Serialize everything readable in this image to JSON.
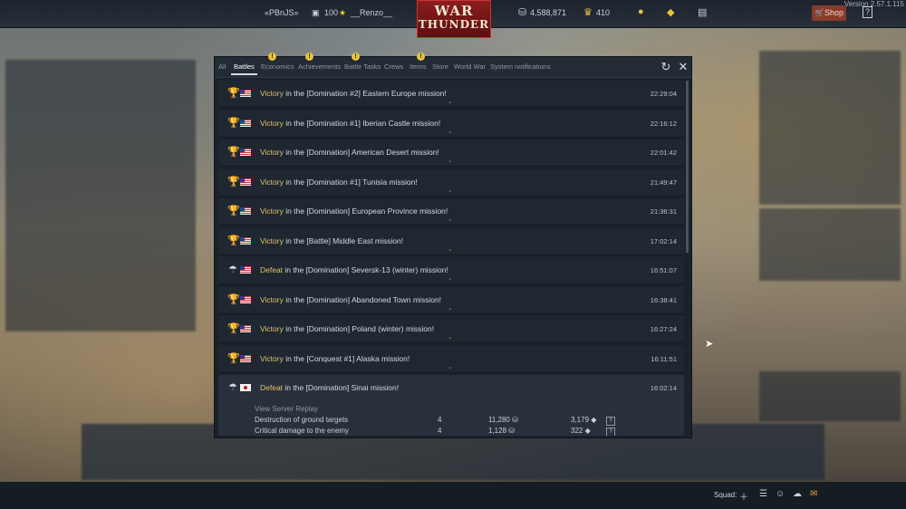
{
  "topbar": {
    "clan": "«PBnJS»",
    "level": "100",
    "username": "__Renzo__",
    "logo_line1": "WAR",
    "logo_line2": "THUNDER",
    "silver": "4,588,871",
    "eagles": "410",
    "shop_label": "Shop",
    "help_label": "?",
    "version": "Version 2.57.1.115"
  },
  "tabs": [
    {
      "label": "All",
      "warn": false
    },
    {
      "label": "Battles",
      "warn": false,
      "active": true
    },
    {
      "label": "Economics",
      "warn": true
    },
    {
      "label": "Achievements",
      "warn": true
    },
    {
      "label": "Battle Tasks",
      "warn": true
    },
    {
      "label": "Crews",
      "warn": false
    },
    {
      "label": "Items",
      "warn": true
    },
    {
      "label": "Store",
      "warn": false
    },
    {
      "label": "World War",
      "warn": false
    },
    {
      "label": "System notifications",
      "warn": false
    }
  ],
  "rows": [
    {
      "result": "Victory",
      "mission": " in the [Domination #2] Eastern Europe mission!",
      "time": "22:29:04",
      "nation": "us",
      "icon": "trophy-icon"
    },
    {
      "result": "Victory",
      "mission": " in the [Domination #1] Iberian Castle mission!",
      "time": "22:16:12",
      "nation": "us",
      "icon": "trophy-icon"
    },
    {
      "result": "Victory",
      "mission": " in the [Domination] American Desert mission!",
      "time": "22:01:42",
      "nation": "us",
      "icon": "trophy-icon"
    },
    {
      "result": "Victory",
      "mission": " in the [Domination #1] Tunisia mission!",
      "time": "21:49:47",
      "nation": "us",
      "icon": "trophy-icon"
    },
    {
      "result": "Victory",
      "mission": " in the [Domination] European Province mission!",
      "time": "21:36:31",
      "nation": "us",
      "icon": "trophy-icon"
    },
    {
      "result": "Victory",
      "mission": " in the [Battle] Middle East mission!",
      "time": "17:02:14",
      "nation": "us",
      "icon": "trophy-icon"
    },
    {
      "result": "Defeat",
      "mission": " in the [Domination] Seversk-13 (winter) mission!",
      "time": "16:51:07",
      "nation": "us",
      "icon": "parachute-icon"
    },
    {
      "result": "Victory",
      "mission": " in the [Domination] Abandoned Town mission!",
      "time": "16:38:41",
      "nation": "us",
      "icon": "trophy-icon"
    },
    {
      "result": "Victory",
      "mission": " in the [Domination] Poland (winter) mission!",
      "time": "16:27:24",
      "nation": "us",
      "icon": "trophy-icon"
    },
    {
      "result": "Victory",
      "mission": " in the [Conquest #1] Alaska mission!",
      "time": "16:11:51",
      "nation": "us",
      "icon": "trophy-icon"
    },
    {
      "result": "Defeat",
      "mission": " in the [Domination] Sinai mission!",
      "time": "16:02:14",
      "nation": "jp",
      "icon": "parachute-icon"
    }
  ],
  "expanded": {
    "replay_label": "View Server Replay",
    "lines": [
      {
        "label": "Destruction of ground targets",
        "count": "4",
        "silver": "11,280",
        "rp": "3,179"
      },
      {
        "label": "Critical damage to the enemy",
        "count": "4",
        "silver": "1,128",
        "rp": "322"
      }
    ]
  },
  "bottom": {
    "squad_label": "Squad:"
  }
}
